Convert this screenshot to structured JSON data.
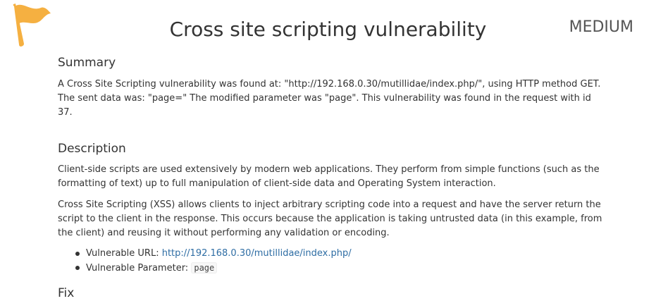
{
  "header": {
    "title": "Cross site scripting vulnerability",
    "severity": "MEDIUM",
    "flag_color": "#F5B041"
  },
  "summary": {
    "heading": "Summary",
    "line1": "A Cross Site Scripting vulnerability was found at: \"http://192.168.0.30/mutillidae/index.php/\", using HTTP method GET.",
    "line2": "The sent data was: \"page=\" The modified parameter was \"page\". This vulnerability was found in the request with id 37."
  },
  "description": {
    "heading": "Description",
    "para1": "Client-side scripts are used extensively by modern web applications. They perform from simple functions (such as the formatting of text) up to full manipulation of client-side data and Operating System interaction.",
    "para2": "Cross Site Scripting (XSS) allows clients to inject arbitrary scripting code into a request and have the server return the script to the client in the response. This occurs because the application is taking untrusted data (in this example, from the client) and reusing it without performing any validation or encoding.",
    "items": [
      {
        "label": "Vulnerable URL:",
        "value": "http://192.168.0.30/mutillidae/index.php/"
      },
      {
        "label": "Vulnerable Parameter:",
        "value": "page"
      }
    ]
  },
  "fix": {
    "heading": "Fix"
  },
  "colors": {
    "link": "#2e6da4",
    "text": "#333333"
  }
}
